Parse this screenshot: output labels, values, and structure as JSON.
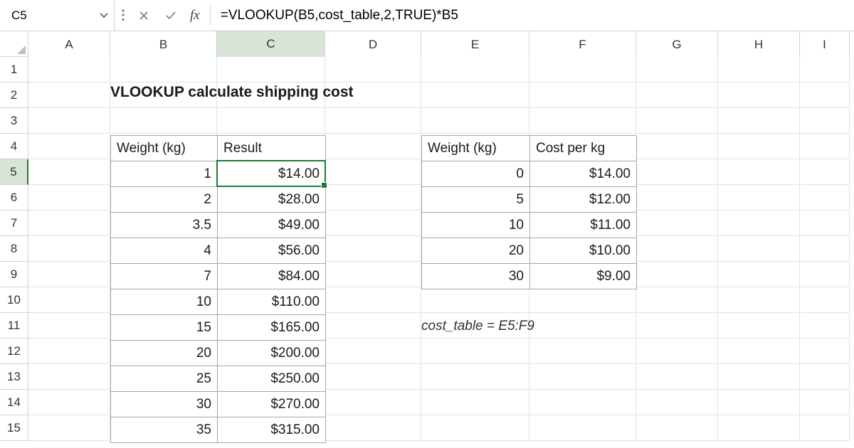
{
  "formula_bar": {
    "cell_ref": "C5",
    "fx_label": "fx",
    "formula": "=VLOOKUP(B5,cost_table,2,TRUE)*B5"
  },
  "columns": [
    "A",
    "B",
    "C",
    "D",
    "E",
    "F",
    "G",
    "H",
    "I"
  ],
  "rows": [
    "1",
    "2",
    "3",
    "4",
    "5",
    "6",
    "7",
    "8",
    "9",
    "10",
    "11",
    "12",
    "13",
    "14",
    "15"
  ],
  "title": "VLOOKUP calculate shipping cost",
  "table_left": {
    "headers": [
      "Weight (kg)",
      "Result"
    ],
    "rows": [
      {
        "w": "1",
        "r": "$14.00"
      },
      {
        "w": "2",
        "r": "$28.00"
      },
      {
        "w": "3.5",
        "r": "$49.00"
      },
      {
        "w": "4",
        "r": "$56.00"
      },
      {
        "w": "7",
        "r": "$84.00"
      },
      {
        "w": "10",
        "r": "$110.00"
      },
      {
        "w": "15",
        "r": "$165.00"
      },
      {
        "w": "20",
        "r": "$200.00"
      },
      {
        "w": "25",
        "r": "$250.00"
      },
      {
        "w": "30",
        "r": "$270.00"
      },
      {
        "w": "35",
        "r": "$315.00"
      }
    ]
  },
  "table_right": {
    "headers": [
      "Weight (kg)",
      "Cost per kg"
    ],
    "rows": [
      {
        "w": "0",
        "c": "$14.00"
      },
      {
        "w": "5",
        "c": "$12.00"
      },
      {
        "w": "10",
        "c": "$11.00"
      },
      {
        "w": "20",
        "c": "$10.00"
      },
      {
        "w": "30",
        "c": "$9.00"
      }
    ]
  },
  "note": "cost_table = E5:F9",
  "active_cell": "C5",
  "chart_data": {
    "type": "table",
    "tables": [
      {
        "name": "shipping_results",
        "range": "B4:C15",
        "columns": [
          "Weight (kg)",
          "Result"
        ],
        "rows": [
          [
            1,
            14.0
          ],
          [
            2,
            28.0
          ],
          [
            3.5,
            49.0
          ],
          [
            4,
            56.0
          ],
          [
            7,
            84.0
          ],
          [
            10,
            110.0
          ],
          [
            15,
            165.0
          ],
          [
            20,
            200.0
          ],
          [
            25,
            250.0
          ],
          [
            30,
            270.0
          ],
          [
            35,
            315.0
          ]
        ],
        "currency": "USD"
      },
      {
        "name": "cost_table",
        "range": "E4:F9",
        "columns": [
          "Weight (kg)",
          "Cost per kg"
        ],
        "rows": [
          [
            0,
            14.0
          ],
          [
            5,
            12.0
          ],
          [
            10,
            11.0
          ],
          [
            20,
            10.0
          ],
          [
            30,
            9.0
          ]
        ],
        "currency": "USD"
      }
    ]
  }
}
